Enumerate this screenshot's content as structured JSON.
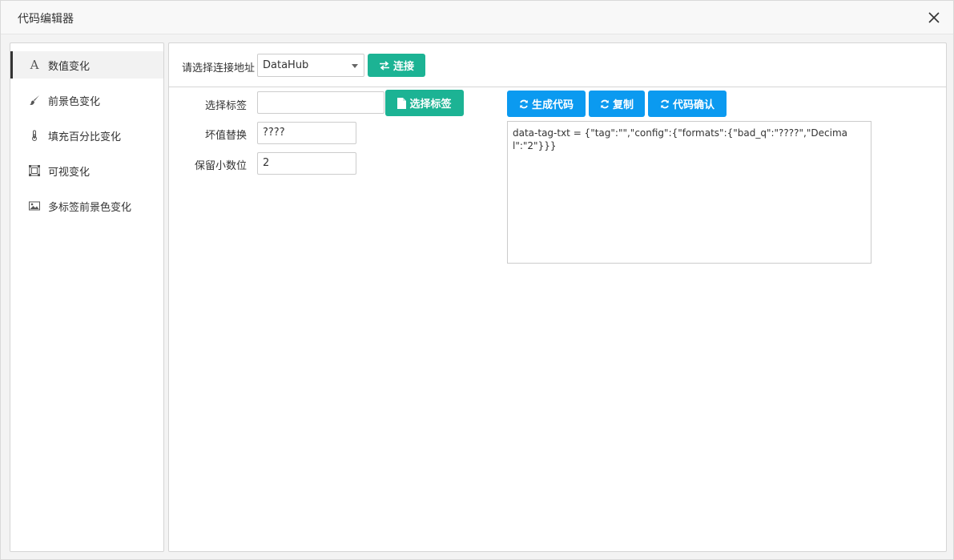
{
  "window": {
    "title": "代码编辑器"
  },
  "sidebar": {
    "items": [
      {
        "label": "数值变化",
        "icon": "font-icon",
        "active": true
      },
      {
        "label": "前景色变化",
        "icon": "brush-icon",
        "active": false
      },
      {
        "label": "填充百分比变化",
        "icon": "thermometer-icon",
        "active": false
      },
      {
        "label": "可视变化",
        "icon": "visibility-frame-icon",
        "active": false
      },
      {
        "label": "多标签前景色变化",
        "icon": "image-icon",
        "active": false
      }
    ]
  },
  "connection": {
    "label": "请选择连接地址",
    "selected": "DataHub",
    "connect_label": "连接"
  },
  "form": {
    "tag_label": "选择标签",
    "tag_value": "",
    "select_tag_label": "选择标签",
    "bad_label": "坏值替换",
    "bad_value": "????",
    "decimal_label": "保留小数位",
    "decimal_value": "2"
  },
  "actions": {
    "generate_label": "生成代码",
    "copy_label": "复制",
    "confirm_label": "代码确认"
  },
  "code": {
    "text": "data-tag-txt = {\"tag\":\"\",\"config\":{\"formats\":{\"bad_q\":\"????\",\"Decimal\":\"2\"}}}"
  },
  "colors": {
    "green": "#1cb394",
    "blue": "#0b9af0",
    "active_border": "#333333"
  }
}
